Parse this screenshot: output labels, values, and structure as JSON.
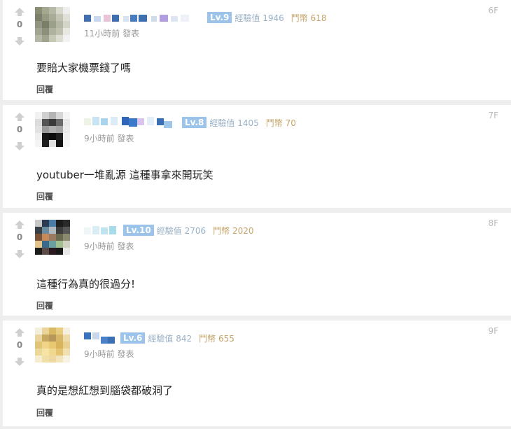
{
  "comments": [
    {
      "floor": "6F",
      "votes": "0",
      "level": "Lv.9",
      "exp_label": "經驗值",
      "exp": "1946",
      "coin_label": "鬥幣",
      "coin": "618",
      "time": "11小時前",
      "post_label": "發表",
      "content": "要賠大家機票錢了嗎",
      "reply": "回覆"
    },
    {
      "floor": "7F",
      "votes": "0",
      "level": "Lv.8",
      "exp_label": "經驗值",
      "exp": "1405",
      "coin_label": "鬥幣",
      "coin": "70",
      "time": "9小時前",
      "post_label": "發表",
      "content": "youtuber一堆亂源 這種事拿來開玩笑",
      "reply": "回覆"
    },
    {
      "floor": "8F",
      "votes": "0",
      "level": "Lv.10",
      "exp_label": "經驗值",
      "exp": "2706",
      "coin_label": "鬥幣",
      "coin": "2020",
      "time": "9小時前",
      "post_label": "發表",
      "content": "這種行為真的很過分!",
      "reply": "回覆"
    },
    {
      "floor": "9F",
      "votes": "0",
      "level": "Lv.6",
      "exp_label": "經驗值",
      "exp": "842",
      "coin_label": "鬥幣",
      "coin": "655",
      "time": "9小時前",
      "post_label": "發表",
      "content": "真的是想紅想到腦袋都破洞了",
      "reply": "回覆"
    }
  ],
  "icons": {
    "vote_up": "arrow-up-icon",
    "vote_down": "arrow-down-icon"
  },
  "colors": {
    "level_badge": "#9cc4ea",
    "exp_text": "#9ab0c4",
    "coin_text": "#c4a46a",
    "arrow": "#cfcfcf"
  }
}
